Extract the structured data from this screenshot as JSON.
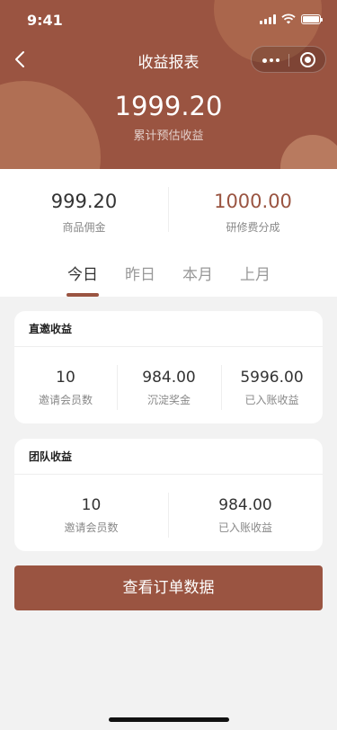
{
  "status_bar": {
    "time": "9:41"
  },
  "nav": {
    "title": "收益报表"
  },
  "header": {
    "total_value": "1999.20",
    "total_label": "累计预估收益"
  },
  "summary": [
    {
      "value": "999.20",
      "label": "商品佣金"
    },
    {
      "value": "1000.00",
      "label": "研修费分成"
    }
  ],
  "tabs": [
    {
      "label": "今日",
      "active": true
    },
    {
      "label": "昨日",
      "active": false
    },
    {
      "label": "本月",
      "active": false
    },
    {
      "label": "上月",
      "active": false
    }
  ],
  "direct_card": {
    "title": "直邀收益",
    "stats": [
      {
        "value": "10",
        "label": "邀请会员数"
      },
      {
        "value": "984.00",
        "label": "沉淀奖金"
      },
      {
        "value": "5996.00",
        "label": "已入账收益"
      }
    ]
  },
  "team_card": {
    "title": "团队收益",
    "stats": [
      {
        "value": "10",
        "label": "邀请会员数"
      },
      {
        "value": "984.00",
        "label": "已入账收益"
      }
    ]
  },
  "actions": {
    "view_orders_label": "查看订单数据"
  },
  "colors": {
    "brand": "#9a5441",
    "background": "#f2f2f2"
  },
  "icons": {
    "back": "chevron-left-icon",
    "menu": "more-dots-icon",
    "close": "target-circle-icon"
  }
}
